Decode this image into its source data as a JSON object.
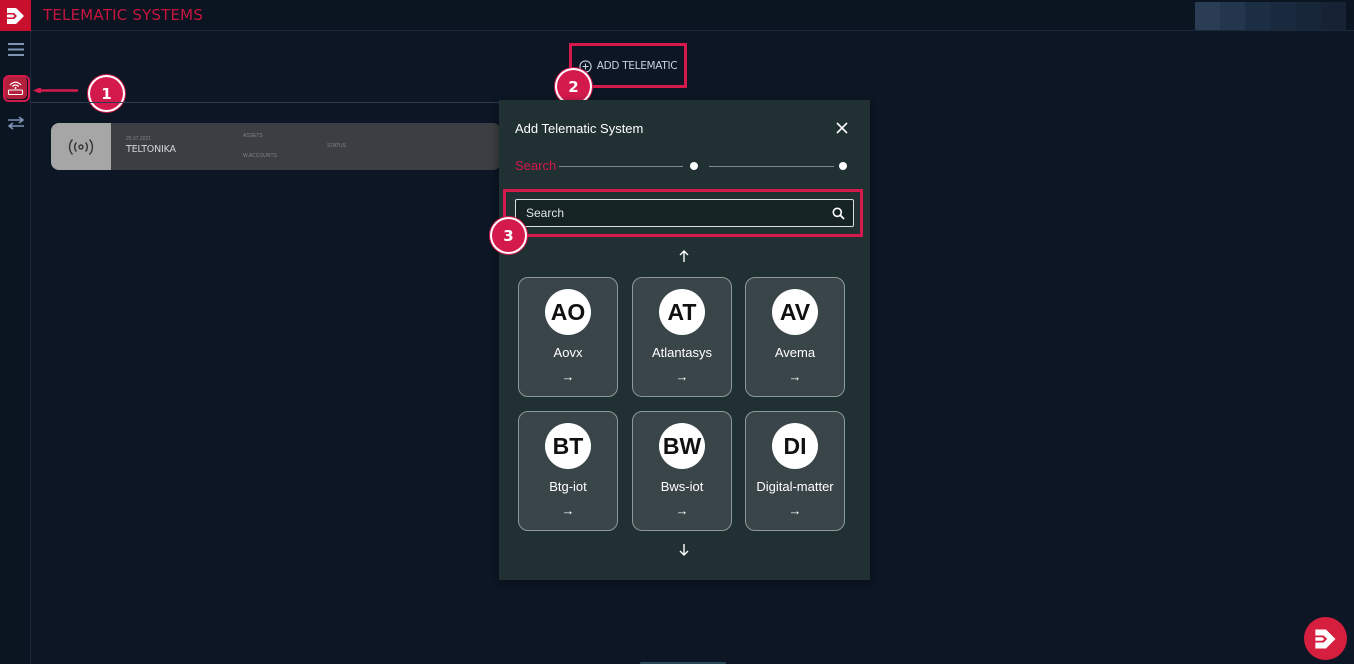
{
  "header": {
    "title": "TELEMATIC SYSTEMS",
    "brand_color": "#c8102e"
  },
  "sidebar": {
    "items": [
      {
        "name": "menu",
        "icon": "hamburger-icon"
      },
      {
        "name": "telematics",
        "icon": "router-wifi-icon",
        "active": true
      },
      {
        "name": "transfer",
        "icon": "swap-arrows-icon"
      }
    ]
  },
  "toolbar": {
    "add_label": "ADD TELEMATIC"
  },
  "list": {
    "items": [
      {
        "date": "25.07.2021",
        "name": "TELTONIKA",
        "assets_label": "ASSETS",
        "accounts_label": "W.ACCOUNTS",
        "status_label": "STATUS"
      }
    ]
  },
  "modal": {
    "title": "Add Telematic System",
    "step_label": "Search",
    "search_placeholder": "Search",
    "systems": [
      {
        "initials": "AO",
        "name": "Aovx",
        "arrow": "→"
      },
      {
        "initials": "AT",
        "name": "Atlantasys",
        "arrow": "→"
      },
      {
        "initials": "AV",
        "name": "Avema",
        "arrow": "→"
      },
      {
        "initials": "BT",
        "name": "Btg-iot",
        "arrow": "→"
      },
      {
        "initials": "BW",
        "name": "Bws-iot",
        "arrow": "→"
      },
      {
        "initials": "DI",
        "name": "Digital-matter",
        "arrow": "→"
      }
    ]
  },
  "annotations": {
    "steps": [
      "1",
      "2",
      "3"
    ],
    "color": "#d41a4d"
  }
}
